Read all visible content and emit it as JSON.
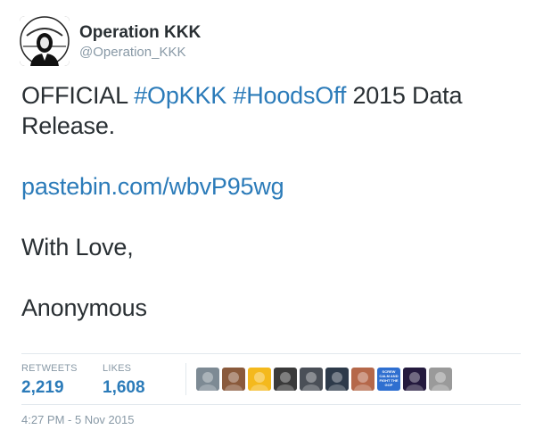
{
  "user": {
    "display_name": "Operation KKK",
    "handle": "@Operation_KKK",
    "avatar_icon": "anonymous-mask-icon"
  },
  "tweet": {
    "line1_prefix": "OFFICIAL ",
    "hashtag1": "#OpKKK",
    "space": " ",
    "hashtag2": "#HoodsOff",
    "line1_suffix": " 2015 Data",
    "line2": "Release.",
    "link": "pastebin.com/wbvP95wg",
    "closing": "With Love,",
    "signature": "Anonymous"
  },
  "stats": {
    "retweets_label": "RETWEETS",
    "retweets_value": "2,219",
    "likes_label": "LIKES",
    "likes_value": "1,608"
  },
  "likers": [
    {
      "name": "liker-avatar-1",
      "color": "#7d8a94"
    },
    {
      "name": "liker-avatar-2",
      "color": "#8a5a3c"
    },
    {
      "name": "liker-avatar-3",
      "color": "#f4b91d"
    },
    {
      "name": "liker-avatar-4",
      "color": "#3a3a3a"
    },
    {
      "name": "liker-avatar-5",
      "color": "#4a4f57"
    },
    {
      "name": "liker-avatar-6",
      "color": "#2d3a4a"
    },
    {
      "name": "liker-avatar-7",
      "color": "#b5684a"
    },
    {
      "name": "liker-avatar-8",
      "color": "#2f6fd0",
      "text": "SCREW CALM AND FIGHT THE GOP"
    },
    {
      "name": "liker-avatar-9",
      "color": "#241a3e"
    },
    {
      "name": "liker-avatar-10",
      "color": "#9a9a9a"
    }
  ],
  "timestamp": "4:27 PM - 5 Nov 2015",
  "colors": {
    "link": "#2b7bb9",
    "text": "#292f33",
    "muted": "#8899a6"
  }
}
